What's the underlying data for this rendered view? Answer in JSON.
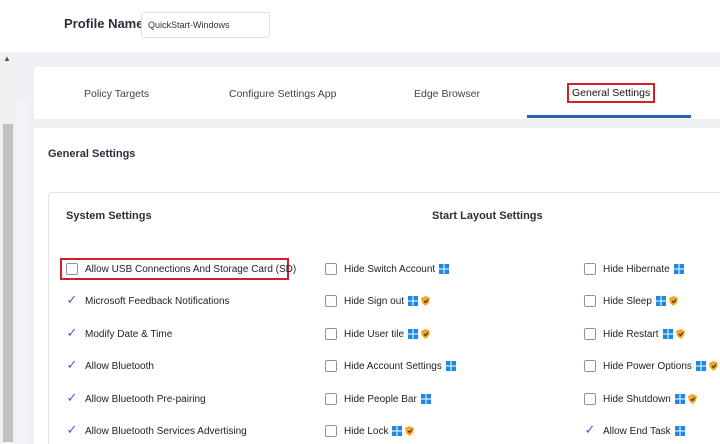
{
  "profile": {
    "label": "Profile Name",
    "value": "QuickStart-Windows"
  },
  "tabs": [
    {
      "label": "Policy Targets"
    },
    {
      "label": "Configure Settings App"
    },
    {
      "label": "Edge Browser"
    },
    {
      "label": "General Settings",
      "active": true
    }
  ],
  "general": {
    "title": "General Settings",
    "system_title": "System Settings",
    "start_title": "Start Layout Settings",
    "system_settings": [
      {
        "label": "Allow USB Connections And Storage Card (SD)",
        "checked": false
      },
      {
        "label": "Microsoft Feedback Notifications",
        "checked": true
      },
      {
        "label": "Modify Date & Time",
        "checked": true
      },
      {
        "label": "Allow Bluetooth",
        "checked": true
      },
      {
        "label": "Allow Bluetooth Pre-pairing",
        "checked": true
      },
      {
        "label": "Allow Bluetooth Services Advertising",
        "checked": true
      }
    ],
    "start_col1": [
      {
        "label": "Hide Switch Account",
        "checked": false,
        "icons": [
          "windows-icon"
        ]
      },
      {
        "label": "Hide Sign out",
        "checked": false,
        "icons": [
          "windows-icon",
          "shield-icon"
        ]
      },
      {
        "label": "Hide User tile",
        "checked": false,
        "icons": [
          "windows-icon",
          "shield-icon"
        ]
      },
      {
        "label": "Hide Account Settings",
        "checked": false,
        "icons": [
          "windows-icon"
        ]
      },
      {
        "label": "Hide People Bar",
        "checked": false,
        "icons": [
          "windows-icon"
        ]
      },
      {
        "label": "Hide Lock",
        "checked": false,
        "icons": [
          "windows-icon",
          "shield-icon"
        ]
      }
    ],
    "start_col2": [
      {
        "label": "Hide Hibernate",
        "checked": false,
        "icons": [
          "windows-icon"
        ]
      },
      {
        "label": "Hide Sleep",
        "checked": false,
        "icons": [
          "windows-icon",
          "shield-icon"
        ]
      },
      {
        "label": "Hide Restart",
        "checked": false,
        "icons": [
          "windows-icon",
          "shield-icon"
        ]
      },
      {
        "label": "Hide Power Options",
        "checked": false,
        "icons": [
          "windows-icon",
          "shield-icon"
        ]
      },
      {
        "label": "Hide Shutdown",
        "checked": false,
        "icons": [
          "windows-icon",
          "shield-icon"
        ]
      },
      {
        "label": "Allow End Task",
        "checked": true,
        "icons": [
          "windows-icon"
        ]
      }
    ]
  },
  "colors": {
    "accent": "#2c5fbd",
    "highlight": "#d32027",
    "windows": "#1e88e5",
    "shield": "#f5a623"
  }
}
